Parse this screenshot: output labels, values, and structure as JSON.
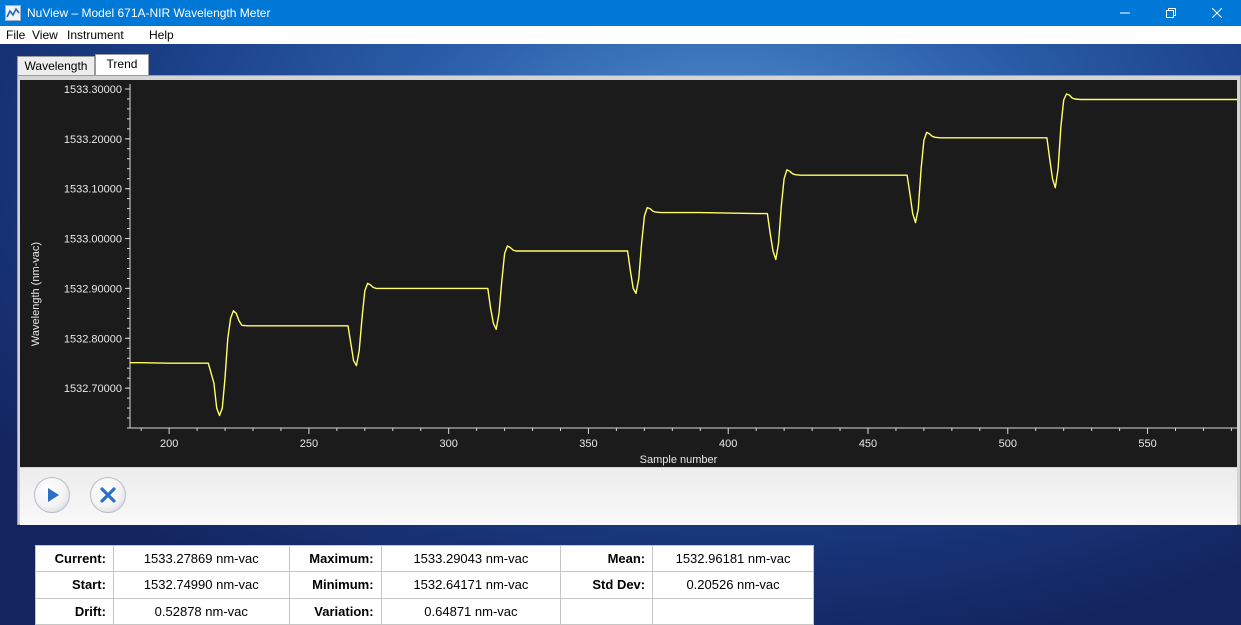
{
  "window": {
    "title": "NuView – Model 671A-NIR Wavelength Meter"
  },
  "menu": {
    "items": [
      "File",
      "View",
      "Instrument",
      "Help"
    ]
  },
  "tabs": [
    {
      "label": "Wavelength",
      "active": false
    },
    {
      "label": "Trend",
      "active": true
    }
  ],
  "chart": {
    "ylabel": "Wavelength (nm-vac)",
    "xlabel": "Sample number",
    "line_color": "#ffff66",
    "background": "#1b1b1b"
  },
  "chart_data": {
    "type": "line",
    "xlabel": "Sample number",
    "ylabel": "Wavelength (nm-vac)",
    "xlim": [
      186,
      582
    ],
    "ylim": [
      1532.62,
      1533.31
    ],
    "x_ticks": [
      200,
      250,
      300,
      350,
      400,
      450,
      500,
      550
    ],
    "x_tick_labels": [
      "200",
      "250",
      "300",
      "350",
      "400",
      "450",
      "500",
      "550"
    ],
    "y_ticks": [
      1532.7,
      1532.8,
      1532.9,
      1533.0,
      1533.1,
      1533.2,
      1533.3
    ],
    "y_tick_labels": [
      "1532.70000",
      "1532.80000",
      "1532.90000",
      "1533.00000",
      "1533.10000",
      "1533.20000",
      "1533.30000"
    ],
    "grid": false,
    "series": [
      {
        "color": "#ffff66",
        "x": [
          186,
          190,
          200,
          210,
          214,
          216,
          217,
          218,
          219,
          220,
          221,
          222,
          223,
          224,
          225,
          226,
          228,
          230,
          240,
          250,
          260,
          264,
          265,
          266,
          267,
          268,
          269,
          270,
          271,
          272,
          273,
          274,
          276,
          278,
          290,
          300,
          310,
          314,
          315,
          316,
          317,
          318,
          319,
          320,
          321,
          322,
          323,
          324,
          326,
          328,
          340,
          350,
          360,
          364,
          365,
          366,
          367,
          368,
          369,
          370,
          371,
          372,
          373,
          374,
          376,
          378,
          390,
          400,
          410,
          414,
          415,
          416,
          417,
          418,
          419,
          420,
          421,
          422,
          423,
          424,
          426,
          428,
          440,
          450,
          460,
          464,
          465,
          466,
          467,
          468,
          469,
          470,
          471,
          472,
          473,
          474,
          476,
          478,
          490,
          500,
          510,
          514,
          515,
          516,
          517,
          518,
          519,
          520,
          521,
          522,
          523,
          524,
          526,
          528,
          540,
          550,
          560,
          570,
          582
        ],
        "y": [
          1532.751,
          1532.751,
          1532.75,
          1532.75,
          1532.75,
          1532.71,
          1532.66,
          1532.645,
          1532.66,
          1532.72,
          1532.8,
          1532.84,
          1532.855,
          1532.85,
          1532.835,
          1532.826,
          1532.825,
          1532.825,
          1532.825,
          1532.825,
          1532.825,
          1532.825,
          1532.79,
          1532.755,
          1532.745,
          1532.775,
          1532.84,
          1532.895,
          1532.91,
          1532.907,
          1532.902,
          1532.9,
          1532.9,
          1532.9,
          1532.9,
          1532.9,
          1532.9,
          1532.9,
          1532.86,
          1532.83,
          1532.818,
          1532.85,
          1532.915,
          1532.97,
          1532.985,
          1532.982,
          1532.977,
          1532.975,
          1532.975,
          1532.975,
          1532.975,
          1532.975,
          1532.975,
          1532.975,
          1532.935,
          1532.9,
          1532.89,
          1532.92,
          1532.99,
          1533.045,
          1533.062,
          1533.06,
          1533.055,
          1533.053,
          1533.052,
          1533.052,
          1533.052,
          1533.051,
          1533.05,
          1533.05,
          1533.01,
          1532.975,
          1532.958,
          1532.99,
          1533.065,
          1533.12,
          1533.138,
          1533.135,
          1533.13,
          1533.128,
          1533.127,
          1533.127,
          1533.127,
          1533.127,
          1533.127,
          1533.127,
          1533.09,
          1533.05,
          1533.032,
          1533.06,
          1533.14,
          1533.197,
          1533.213,
          1533.21,
          1533.205,
          1533.203,
          1533.202,
          1533.202,
          1533.202,
          1533.202,
          1533.202,
          1533.202,
          1533.16,
          1533.12,
          1533.102,
          1533.14,
          1533.225,
          1533.278,
          1533.29,
          1533.288,
          1533.282,
          1533.28,
          1533.279,
          1533.279,
          1533.279,
          1533.279,
          1533.279,
          1533.279,
          1533.279
        ]
      }
    ]
  },
  "buttons": {
    "start": {
      "icon": "play-icon"
    },
    "stop": {
      "icon": "close-icon"
    }
  },
  "stats": {
    "current_label": "Current:",
    "current_value": "1533.27869 nm-vac",
    "maximum_label": "Maximum:",
    "maximum_value": "1533.29043 nm-vac",
    "mean_label": "Mean:",
    "mean_value": "1532.96181 nm-vac",
    "start_label": "Start:",
    "start_value": "1532.74990 nm-vac",
    "minimum_label": "Minimum:",
    "minimum_value": "1532.64171 nm-vac",
    "stddev_label": "Std Dev:",
    "stddev_value": "0.20526 nm-vac",
    "drift_label": "Drift:",
    "drift_value": "0.52878 nm-vac",
    "variation_label": "Variation:",
    "variation_value": "0.64871 nm-vac"
  }
}
